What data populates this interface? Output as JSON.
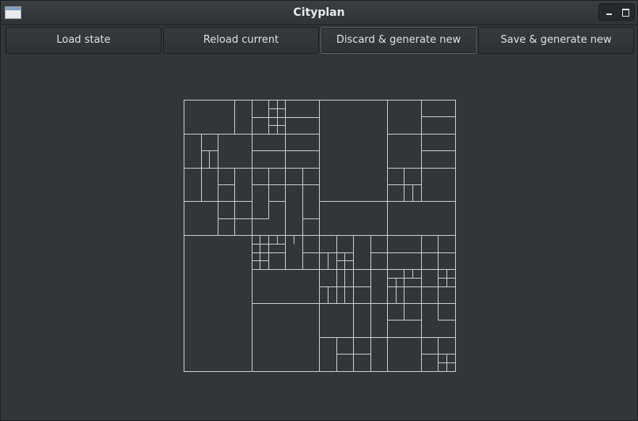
{
  "window": {
    "title": "Cityplan"
  },
  "icons": {
    "app": "window-app-icon",
    "minimize": "minimize-icon",
    "maximize": "maximize-icon"
  },
  "toolbar": {
    "buttons": [
      {
        "label": "Load state"
      },
      {
        "label": "Reload current"
      },
      {
        "label": "Discard & generate new"
      },
      {
        "label": "Save & generate new"
      }
    ]
  },
  "colors": {
    "background": "#323639",
    "lines": "#c9cccd",
    "text": "#dfe1e2"
  }
}
